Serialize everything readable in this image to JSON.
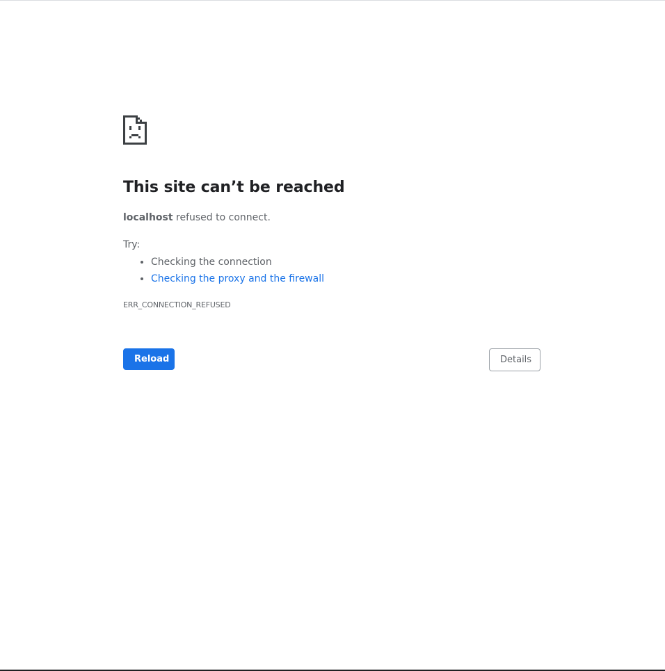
{
  "icon": {
    "name": "sad-page-icon",
    "color": "#3c4043"
  },
  "heading": "This site can’t be reached",
  "summary": {
    "host": "localhost",
    "message": " refused to connect."
  },
  "try_label": "Try:",
  "suggestions": [
    {
      "label": "Checking the connection",
      "is_link": false
    },
    {
      "label": "Checking the proxy and the firewall",
      "is_link": true
    }
  ],
  "error_code": "ERR_CONNECTION_REFUSED",
  "buttons": {
    "reload": "Reload",
    "details": "Details"
  },
  "colors": {
    "accent": "#1a73e8",
    "text": "#5f6368",
    "heading": "#202124"
  }
}
